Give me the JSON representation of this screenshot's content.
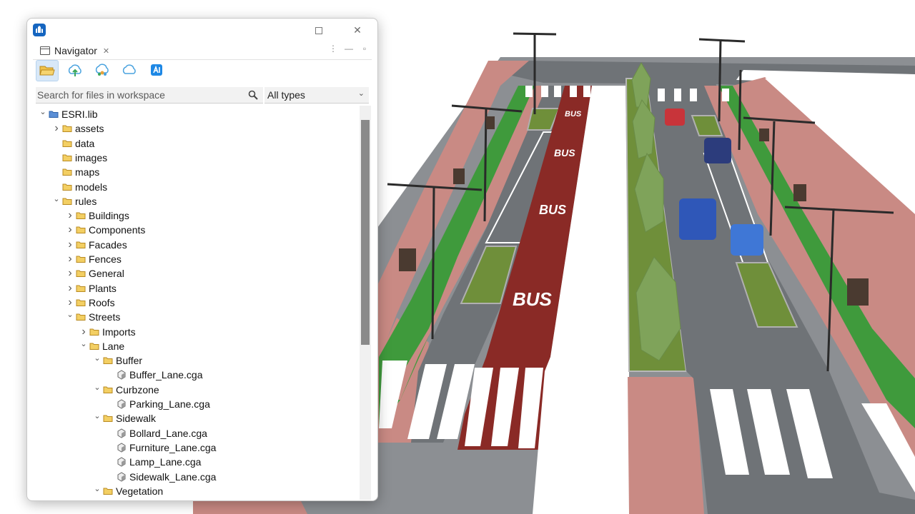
{
  "window": {
    "tab_label": "Navigator"
  },
  "toolbar": {
    "buttons": [
      "folder-open-icon",
      "cloud-upload-icon",
      "cloud-people-icon",
      "cloud-icon",
      "ai-app-icon"
    ]
  },
  "search": {
    "placeholder": "Search for files in workspace",
    "value": "",
    "type_filter": "All types"
  },
  "tree": [
    {
      "label": "ESRI.lib",
      "depth": 0,
      "kind": "project",
      "expanded": true
    },
    {
      "label": "assets",
      "depth": 1,
      "kind": "folder",
      "expanded": false
    },
    {
      "label": "data",
      "depth": 1,
      "kind": "folder",
      "expanded": null
    },
    {
      "label": "images",
      "depth": 1,
      "kind": "folder",
      "expanded": null
    },
    {
      "label": "maps",
      "depth": 1,
      "kind": "folder",
      "expanded": null
    },
    {
      "label": "models",
      "depth": 1,
      "kind": "folder",
      "expanded": null
    },
    {
      "label": "rules",
      "depth": 1,
      "kind": "folder",
      "expanded": true
    },
    {
      "label": "Buildings",
      "depth": 2,
      "kind": "folder",
      "expanded": false
    },
    {
      "label": "Components",
      "depth": 2,
      "kind": "folder",
      "expanded": false
    },
    {
      "label": "Facades",
      "depth": 2,
      "kind": "folder",
      "expanded": false
    },
    {
      "label": "Fences",
      "depth": 2,
      "kind": "folder",
      "expanded": false
    },
    {
      "label": "General",
      "depth": 2,
      "kind": "folder",
      "expanded": false
    },
    {
      "label": "Plants",
      "depth": 2,
      "kind": "folder",
      "expanded": false
    },
    {
      "label": "Roofs",
      "depth": 2,
      "kind": "folder",
      "expanded": false
    },
    {
      "label": "Streets",
      "depth": 2,
      "kind": "folder",
      "expanded": true
    },
    {
      "label": "Imports",
      "depth": 3,
      "kind": "folder",
      "expanded": false
    },
    {
      "label": "Lane",
      "depth": 3,
      "kind": "folder",
      "expanded": true
    },
    {
      "label": "Buffer",
      "depth": 4,
      "kind": "folder",
      "expanded": true
    },
    {
      "label": "Buffer_Lane.cga",
      "depth": 5,
      "kind": "file",
      "expanded": null
    },
    {
      "label": "Curbzone",
      "depth": 4,
      "kind": "folder",
      "expanded": true
    },
    {
      "label": "Parking_Lane.cga",
      "depth": 5,
      "kind": "file",
      "expanded": null
    },
    {
      "label": "Sidewalk",
      "depth": 4,
      "kind": "folder",
      "expanded": true
    },
    {
      "label": "Bollard_Lane.cga",
      "depth": 5,
      "kind": "file",
      "expanded": null
    },
    {
      "label": "Furniture_Lane.cga",
      "depth": 5,
      "kind": "file",
      "expanded": null
    },
    {
      "label": "Lamp_Lane.cga",
      "depth": 5,
      "kind": "file",
      "expanded": null
    },
    {
      "label": "Sidewalk_Lane.cga",
      "depth": 5,
      "kind": "file",
      "expanded": null
    },
    {
      "label": "Vegetation",
      "depth": 4,
      "kind": "folder",
      "expanded": true
    }
  ],
  "scene": {
    "bus_lane_text": [
      "BUS",
      "BUS",
      "BUS",
      "BUS"
    ],
    "colors": {
      "road": "#6f7377",
      "sidewalk": "#c98a84",
      "bike_lane": "#3f9a3c",
      "bus_lane": "#8a2a26",
      "median_grass": "#6f8f3a",
      "markings": "#ffffff"
    }
  }
}
